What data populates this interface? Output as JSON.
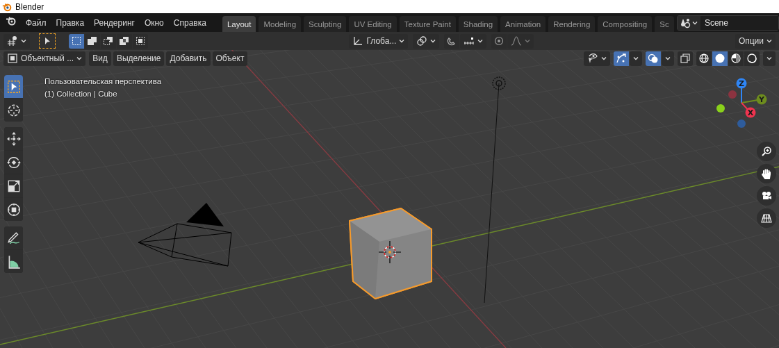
{
  "window": {
    "title": "Blender"
  },
  "menu_bar": {
    "items": [
      "Файл",
      "Правка",
      "Рендеринг",
      "Окно",
      "Справка"
    ]
  },
  "workspace_tabs": [
    {
      "label": "Layout",
      "selected": true
    },
    {
      "label": "Modeling",
      "selected": false
    },
    {
      "label": "Sculpting",
      "selected": false
    },
    {
      "label": "UV Editing",
      "selected": false
    },
    {
      "label": "Texture Paint",
      "selected": false
    },
    {
      "label": "Shading",
      "selected": false
    },
    {
      "label": "Animation",
      "selected": false
    },
    {
      "label": "Rendering",
      "selected": false
    },
    {
      "label": "Compositing",
      "selected": false
    },
    {
      "label": "Sc",
      "selected": false
    }
  ],
  "scene": {
    "value": "Scene"
  },
  "tool_header": {
    "select_modes": [
      {
        "kind": "new",
        "selected": true
      },
      {
        "kind": "extend",
        "selected": false
      },
      {
        "kind": "subtract",
        "selected": false
      },
      {
        "kind": "invert",
        "selected": false
      },
      {
        "kind": "intersect",
        "selected": false
      }
    ],
    "transform_orientation": "Глоба...",
    "options_label": "Опции"
  },
  "viewport_header": {
    "mode": "Объектный ...",
    "menus": [
      "Вид",
      "Выделение",
      "Добавить",
      "Объект"
    ],
    "gizmos_on": true,
    "overlays_on": true,
    "xray_on": false,
    "shading_modes": [
      {
        "kind": "wireframe",
        "selected": false
      },
      {
        "kind": "solid",
        "selected": true
      },
      {
        "kind": "material",
        "selected": false
      },
      {
        "kind": "rendered",
        "selected": false
      }
    ]
  },
  "viewport": {
    "view_name": "Пользовательская перспектива",
    "collection_info": "(1) Collection | Cube"
  },
  "toolbar": {
    "groups": [
      {
        "tools": [
          {
            "kind": "select",
            "selected": true
          },
          {
            "kind": "cursor",
            "selected": false
          }
        ]
      },
      {
        "tools": [
          {
            "kind": "move",
            "selected": false
          },
          {
            "kind": "rotate",
            "selected": false
          },
          {
            "kind": "scale",
            "selected": false
          },
          {
            "kind": "transform",
            "selected": false
          }
        ]
      },
      {
        "tools": [
          {
            "kind": "annotate",
            "selected": false
          },
          {
            "kind": "measure",
            "selected": false
          }
        ]
      }
    ]
  },
  "navigation_gizmo": {
    "axes": [
      {
        "label": "Z",
        "color": "#2f86f6"
      },
      {
        "label": "Y",
        "color": "#6d8c1e"
      },
      {
        "label": "X",
        "color": "#f0344f"
      }
    ],
    "negative_axes": [
      {
        "color": "#8c3340"
      },
      {
        "color": "#8ad11b"
      },
      {
        "color": "#2e5c9c"
      }
    ]
  }
}
